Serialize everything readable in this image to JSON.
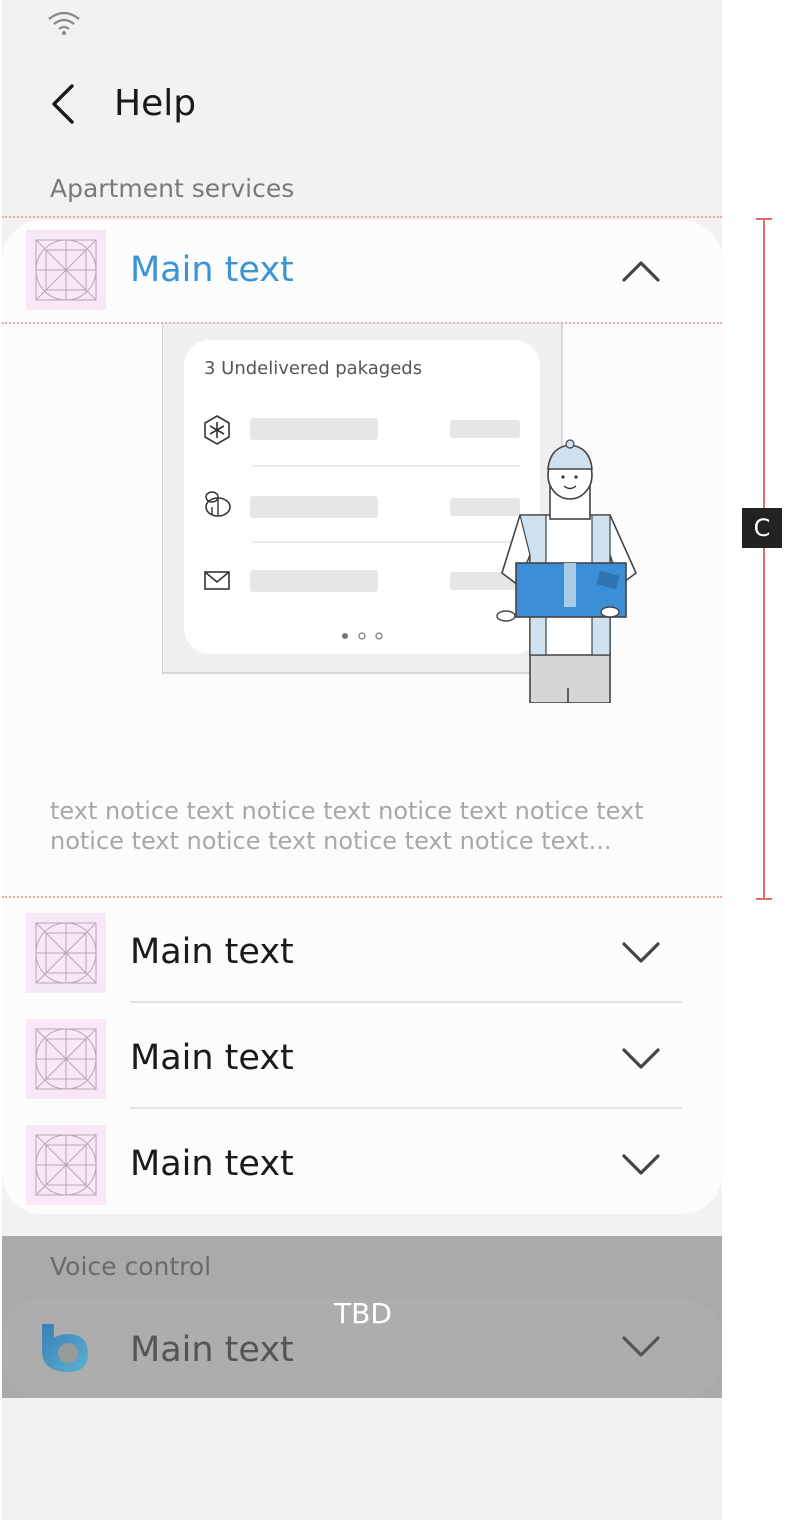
{
  "header": {
    "title": "Help"
  },
  "sections": {
    "apartment": "Apartment services",
    "voice": "Voice control"
  },
  "expanded_item": {
    "label": "Main text",
    "notice": "text notice text notice text notice text notice text notice text notice text notice text notice text...",
    "illustration": {
      "card_title": "3 Undelivered pakageds",
      "icons": [
        "asterisk-hex-icon",
        "bee-icon",
        "mail-icon"
      ]
    }
  },
  "collapsed_items": [
    {
      "label": "Main text"
    },
    {
      "label": "Main text"
    },
    {
      "label": "Main text"
    }
  ],
  "voice_item": {
    "label": "Main text",
    "overlay": "TBD"
  },
  "measure": {
    "label": "C"
  },
  "colors": {
    "accent": "#3b94d6",
    "background": "#f2f2f2",
    "card": "#fcfcfc",
    "guideline": "#f2a3a3"
  }
}
